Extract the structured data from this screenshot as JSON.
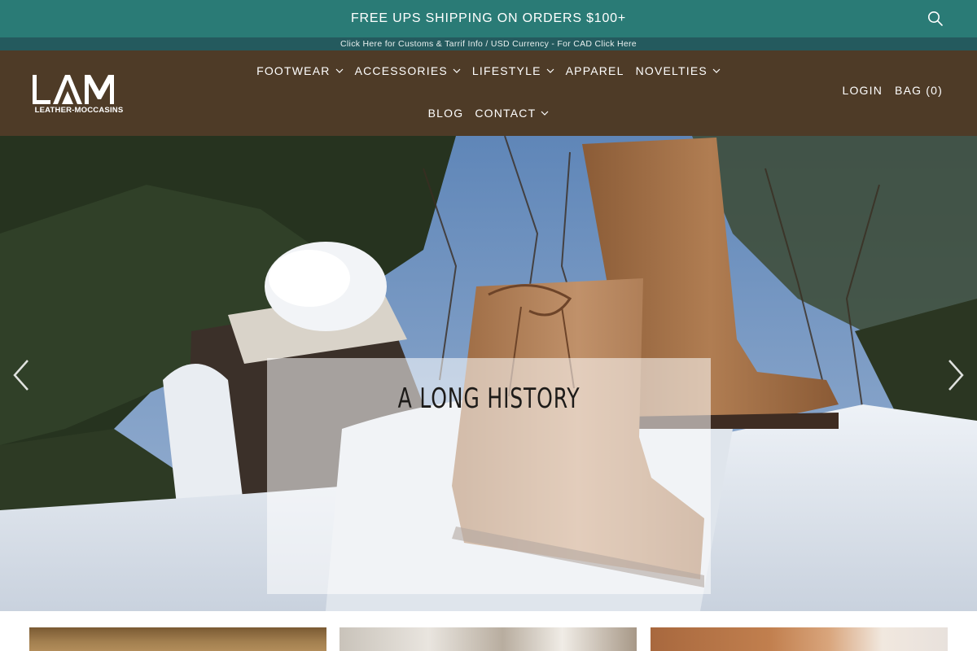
{
  "announcement": {
    "text": "FREE UPS SHIPPING ON ORDERS $100+",
    "search_icon": "search-icon"
  },
  "subbar": {
    "text": "Click Here for Customs & Tarrif Info / USD Currency - For CAD Click Here"
  },
  "brand": {
    "logo_text": "LAM",
    "logo_subtext": "LEATHER-MOCCASINS"
  },
  "nav": {
    "row1": [
      {
        "label": "FOOTWEAR",
        "has_dropdown": true
      },
      {
        "label": "ACCESSORIES",
        "has_dropdown": true
      },
      {
        "label": "LIFESTYLE",
        "has_dropdown": true
      },
      {
        "label": "APPAREL",
        "has_dropdown": false
      },
      {
        "label": "NOVELTIES",
        "has_dropdown": true
      }
    ],
    "row2": [
      {
        "label": "BLOG",
        "has_dropdown": false
      },
      {
        "label": "CONTACT",
        "has_dropdown": true
      }
    ]
  },
  "account": {
    "login": "LOGIN",
    "bag": "BAG (0)"
  },
  "hero": {
    "title": "A LONG HISTORY",
    "prev_icon": "chevron-left-icon",
    "next_icon": "chevron-right-icon"
  },
  "colors": {
    "announcement_bg": "#2a7b76",
    "subbar_bg": "#245a5e",
    "header_bg": "#4e3b27",
    "text_light": "#ffffff"
  }
}
